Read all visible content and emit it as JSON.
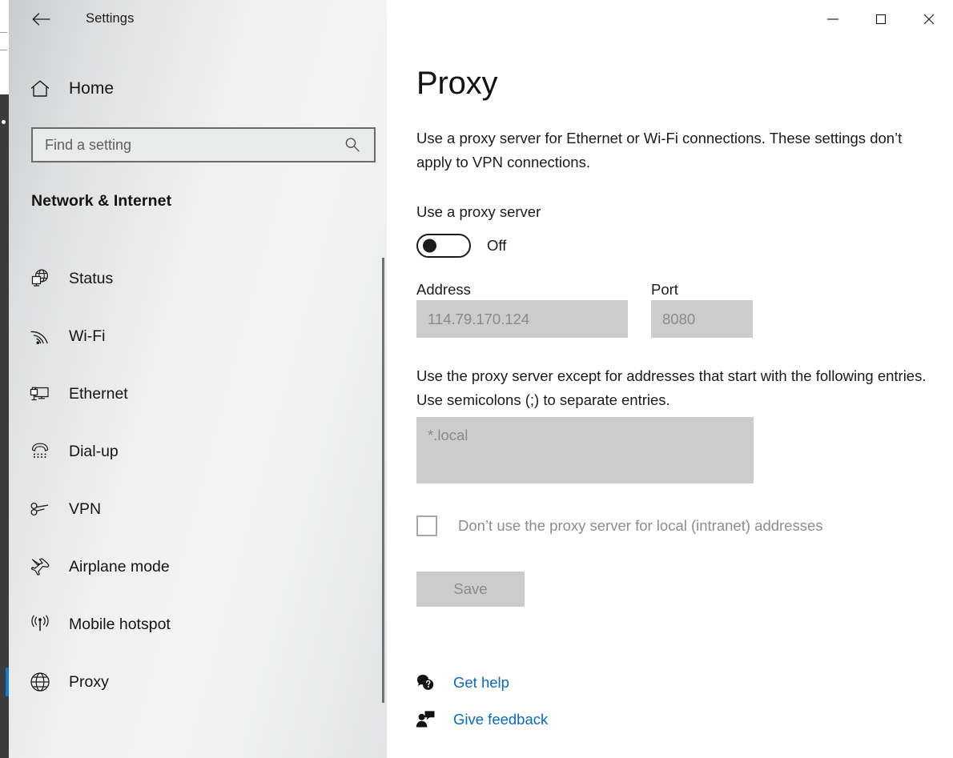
{
  "window": {
    "app_title": "Settings",
    "back_icon": "back-arrow-icon",
    "controls": {
      "minimize": "minimize-icon",
      "maximize": "maximize-icon",
      "close": "close-icon"
    }
  },
  "sidebar": {
    "home_label": "Home",
    "home_icon": "home-icon",
    "search": {
      "placeholder": "Find a setting",
      "value": "",
      "icon": "search-icon"
    },
    "section_title": "Network & Internet",
    "items": [
      {
        "label": "Status",
        "icon": "globe-monitor-icon",
        "selected": false
      },
      {
        "label": "Wi-Fi",
        "icon": "wifi-icon",
        "selected": false
      },
      {
        "label": "Ethernet",
        "icon": "ethernet-icon",
        "selected": false
      },
      {
        "label": "Dial-up",
        "icon": "dialup-phone-icon",
        "selected": false
      },
      {
        "label": "VPN",
        "icon": "vpn-key-icon",
        "selected": false
      },
      {
        "label": "Airplane mode",
        "icon": "airplane-icon",
        "selected": false
      },
      {
        "label": "Mobile hotspot",
        "icon": "hotspot-icon",
        "selected": false
      },
      {
        "label": "Proxy",
        "icon": "globe-icon",
        "selected": true
      }
    ]
  },
  "main": {
    "title": "Proxy",
    "description": "Use a proxy server for Ethernet or Wi-Fi connections. These settings don’t apply to VPN connections.",
    "proxy_toggle": {
      "label": "Use a proxy server",
      "state_text": "Off",
      "checked": false
    },
    "address": {
      "label": "Address",
      "value": "114.79.170.124",
      "placeholder": "114.79.170.124",
      "disabled": true
    },
    "port": {
      "label": "Port",
      "value": "8080",
      "placeholder": "8080",
      "disabled": true
    },
    "exceptions": {
      "description": "Use the proxy server except for addresses that start with the following entries. Use semicolons (;) to separate entries.",
      "value": "*.local",
      "placeholder": "*.local",
      "disabled": true
    },
    "bypass_checkbox": {
      "label": "Don’t use the proxy server for local (intranet) addresses",
      "checked": false,
      "disabled": true
    },
    "save_button": {
      "label": "Save",
      "disabled": true
    },
    "links": [
      {
        "label": "Get help",
        "icon": "question-bubble-icon"
      },
      {
        "label": "Give feedback",
        "icon": "person-feedback-icon"
      }
    ]
  },
  "colors": {
    "accent": "#0a7cd6",
    "link": "#0a68c4",
    "disabled_field_bg": "#cccccc",
    "disabled_text": "#8a8a8a"
  }
}
